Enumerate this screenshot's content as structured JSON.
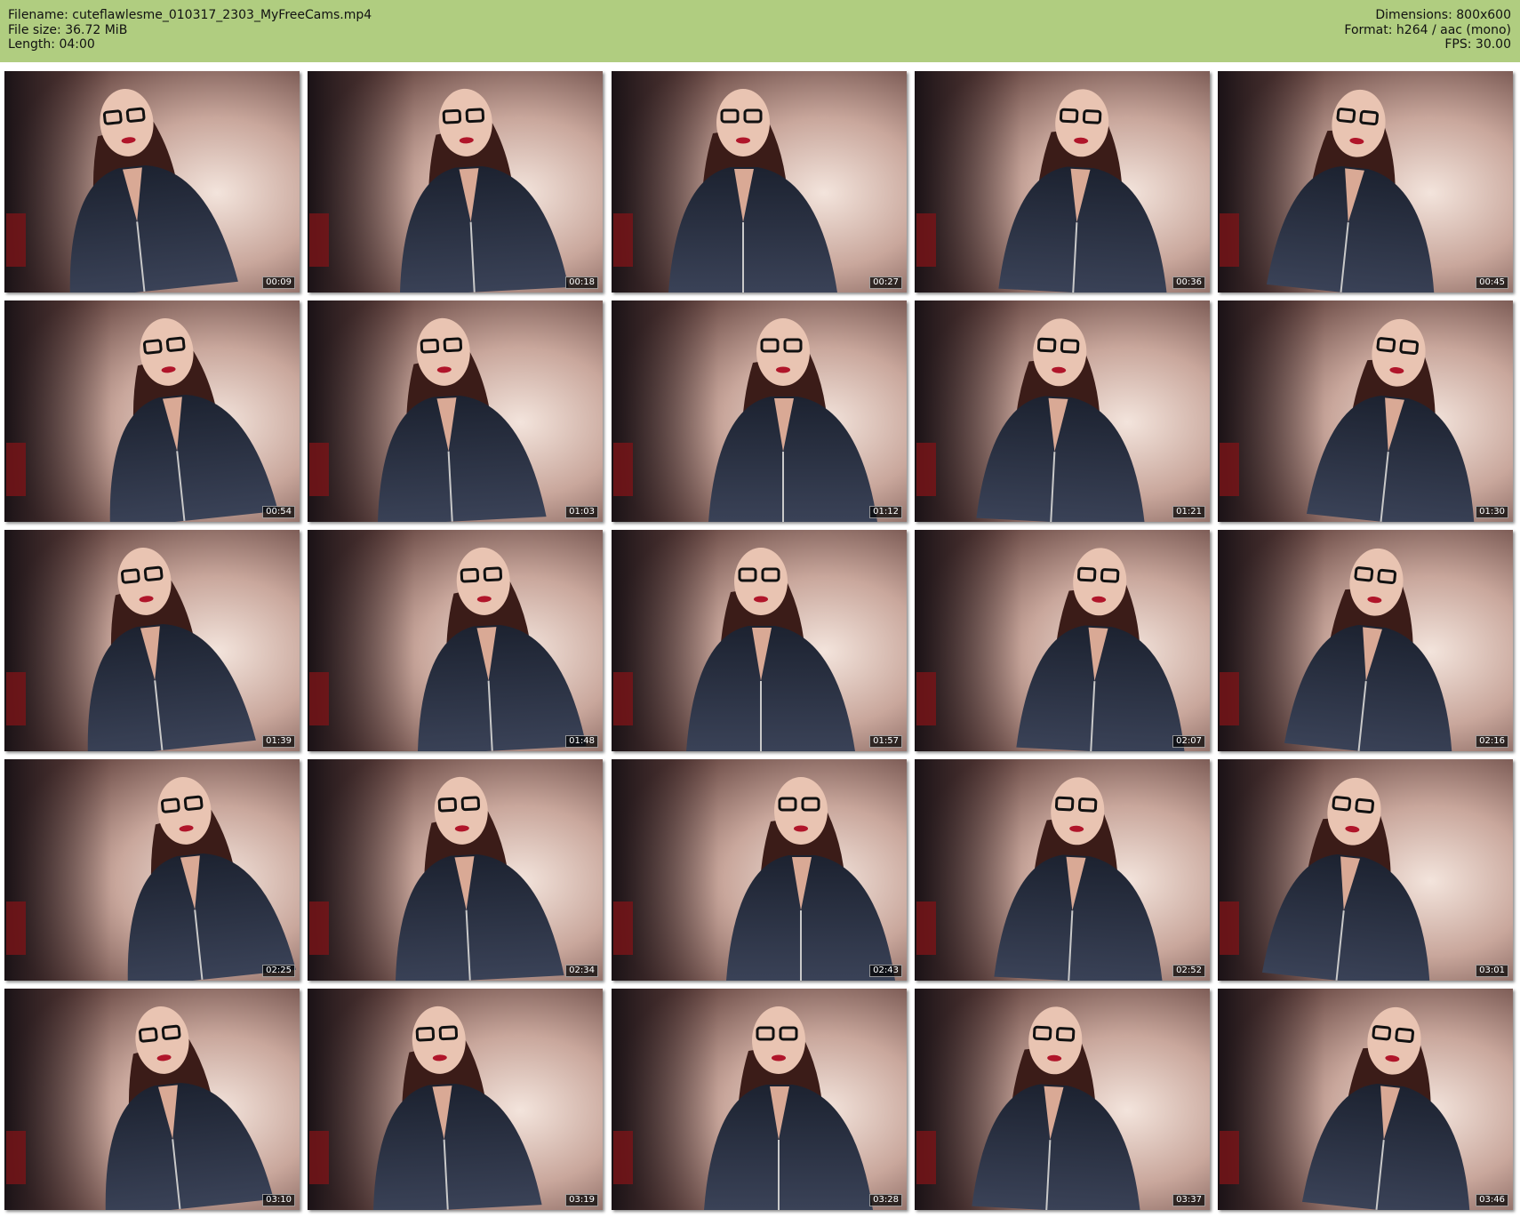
{
  "header": {
    "filename_label": "Filename: cuteflawlesme_010317_2303_MyFreeCams.mp4",
    "filesize_label": "File size: 36.72 MiB",
    "length_label": "Length: 04:00",
    "dimensions_label": "Dimensions: 800x600",
    "format_label": "Format: h264 / aac (mono)",
    "fps_label": "FPS: 30.00",
    "background_color": "#b0cd80"
  },
  "thumbnails": [
    {
      "timestamp": "00:09"
    },
    {
      "timestamp": "00:18"
    },
    {
      "timestamp": "00:27"
    },
    {
      "timestamp": "00:36"
    },
    {
      "timestamp": "00:45"
    },
    {
      "timestamp": "00:54"
    },
    {
      "timestamp": "01:03"
    },
    {
      "timestamp": "01:12"
    },
    {
      "timestamp": "01:21"
    },
    {
      "timestamp": "01:30"
    },
    {
      "timestamp": "01:39"
    },
    {
      "timestamp": "01:48"
    },
    {
      "timestamp": "01:57"
    },
    {
      "timestamp": "02:07"
    },
    {
      "timestamp": "02:16"
    },
    {
      "timestamp": "02:25"
    },
    {
      "timestamp": "02:34"
    },
    {
      "timestamp": "02:43"
    },
    {
      "timestamp": "02:52"
    },
    {
      "timestamp": "03:01"
    },
    {
      "timestamp": "03:10"
    },
    {
      "timestamp": "03:19"
    },
    {
      "timestamp": "03:28"
    },
    {
      "timestamp": "03:37"
    },
    {
      "timestamp": "03:46"
    }
  ]
}
